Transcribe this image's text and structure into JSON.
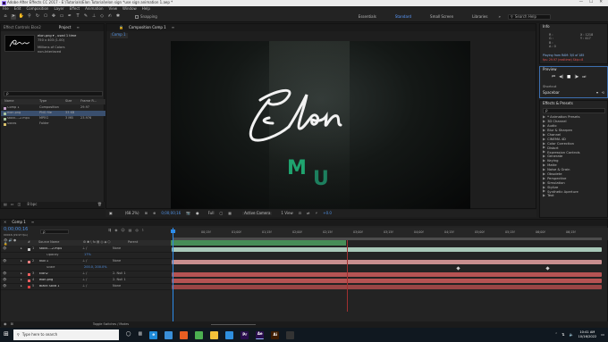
{
  "title_bar": {
    "title": "Adobe After Effects CC 2017 - E:\\Tutorials\\Elon Tutorial\\elon sign *use sign animation 1.aep *",
    "minimize": "—",
    "maximize": "☐",
    "close": "✕"
  },
  "menu": [
    "File",
    "Edit",
    "Composition",
    "Layer",
    "Effect",
    "Animation",
    "View",
    "Window",
    "Help"
  ],
  "toolbar": {
    "snapping_label": "Snapping",
    "workspaces": [
      "Essentials",
      "Standard",
      "Small Screen",
      "Libraries"
    ],
    "active_workspace": "Standard",
    "workspace_more": "»",
    "search_placeholder": "Search Help"
  },
  "project_panel": {
    "tabs": [
      "Effect Controls Elon2",
      "Project",
      "≡"
    ],
    "active_tab": "Project",
    "file_name": "elon.png ▾ , used 1 time",
    "dimensions": "750 x 403 (1.00)",
    "color_info": "Millions of Colors",
    "interlace": "non-Interlaced",
    "search_placeholder": "ρ",
    "columns": [
      "Name",
      "Type",
      "Size",
      "Frame R..."
    ],
    "items": [
      {
        "name": "Comp 1",
        "type": "Composition",
        "size": "",
        "fr": "29.97",
        "color": "#c1a0c8",
        "icon": "composition-icon"
      },
      {
        "name": "elon.png",
        "type": "PNG file",
        "size": "33 KB",
        "fr": "",
        "color": "#a7c4a0",
        "icon": "image-icon"
      },
      {
        "name": "stock-...2.mp4",
        "type": "MPEG",
        "size": "3 MB",
        "fr": "23.976",
        "color": "#a7c4a0",
        "icon": "footage-icon"
      },
      {
        "name": "Solids",
        "type": "Folder",
        "size": "",
        "fr": "",
        "color": "#d8c06a",
        "icon": "folder-icon"
      }
    ],
    "bpc": "8 bpc"
  },
  "composition_panel": {
    "tab_label": "Composition Comp 1",
    "breadcrumb": "Comp 1",
    "elon_text": "Elon",
    "mu_m": "M",
    "mu_u": "U",
    "zoom": "(68.2%)",
    "timecode": "0;00;00;16",
    "resolution": "Full",
    "camera": "Active Camera",
    "views": "1 View",
    "exposure": "+0.0"
  },
  "info_panel": {
    "title": "Info",
    "r": "R :",
    "g": "G :",
    "b": "B :",
    "a": "A : 0",
    "x": "X : 1218",
    "y": "Y : 417",
    "status1": "Playing from RAM: 3/0 of 185",
    "status2": "fps: 29.97 (realtime) Skip=8"
  },
  "preview_panel": {
    "title": "Preview",
    "shortcut_label": "Shortcut",
    "shortcut_value": "Spacebar"
  },
  "effects_panel": {
    "title": "Effects & Presets",
    "search_placeholder": "ρ",
    "items": [
      "* Animation Presets",
      "3D Channel",
      "Audio",
      "Blur & Sharpen",
      "Channel",
      "CINEMA 4D",
      "Color Correction",
      "Distort",
      "Expression Controls",
      "Generate",
      "Keying",
      "Matte",
      "Noise & Grain",
      "Obsolete",
      "Perspective",
      "Simulation",
      "Stylize",
      "Synthetic Aperture",
      "Text"
    ]
  },
  "timeline": {
    "comp_tab": "Comp 1",
    "timecode": "0;00;00;16",
    "frames": "00016 (29.97 fps)",
    "search_placeholder": "ρ",
    "columns": [
      "#",
      "Source Name",
      "Parent"
    ],
    "ruler": [
      "0f",
      "00;15f",
      "01;00f",
      "01;15f",
      "02;00f",
      "02;15f",
      "03;00f",
      "03;15f",
      "04;00f",
      "04;15f",
      "05;00f",
      "05;15f",
      "06;00f",
      "06;15f"
    ],
    "layers": [
      {
        "num": "1",
        "name": "stock-...2.mp4",
        "parent": "None",
        "color": "#c8c8c8",
        "bar": "#a8c8b8",
        "indent": 0
      },
      {
        "num": "",
        "name": "Opacity",
        "parent": "",
        "value": "17%",
        "color": "",
        "bar": "",
        "indent": 1
      },
      {
        "num": "2",
        "name": "Null 1",
        "parent": "None",
        "color": "#ee8080",
        "bar": "#c98e8e",
        "indent": 0
      },
      {
        "num": "",
        "name": "Scale",
        "parent": "",
        "value": "200.0, 200.0%",
        "color": "",
        "bar": "",
        "indent": 1
      },
      {
        "num": "3",
        "name": "Elon2",
        "parent": "2. Null 1",
        "color": "#ee6060",
        "bar": "#b65353",
        "indent": 0
      },
      {
        "num": "4",
        "name": "elon.png",
        "parent": "2. Null 1",
        "color": "#ee6060",
        "bar": "#b65353",
        "indent": 0
      },
      {
        "num": "5",
        "name": "Black Solid 1",
        "parent": "None",
        "color": "#dd4444",
        "bar": "#9a4545",
        "indent": 0
      }
    ],
    "toggle_label": "Toggle Switches / Modes"
  },
  "taskbar": {
    "search_placeholder": "Type here to search",
    "time": "10:41 AM",
    "date": "10/16/2022",
    "apps": [
      {
        "icon": "edge-icon",
        "label": "e",
        "color": "#1f8ad8"
      },
      {
        "icon": "store-icon",
        "label": "",
        "color": "#3a8fd9"
      },
      {
        "icon": "ps-icon",
        "label": "",
        "color": "#e85e22"
      },
      {
        "icon": "chrome-icon",
        "label": "",
        "color": "#4caf50"
      },
      {
        "icon": "explorer-icon",
        "label": "",
        "color": "#f3c13a"
      },
      {
        "icon": "vscode-icon",
        "label": "",
        "color": "#2f8fde"
      },
      {
        "icon": "premiere-icon",
        "label": "Pr",
        "color": "#2a0e4e"
      },
      {
        "icon": "ae-icon",
        "label": "Ae",
        "color": "#2a0e4e"
      },
      {
        "icon": "ai-icon",
        "label": "Ai",
        "color": "#3e1d00"
      },
      {
        "icon": "obs-icon",
        "label": "",
        "color": "#333"
      }
    ]
  },
  "colors": {
    "accent_blue": "#2d8ceb",
    "mu_green": "#1fa46f",
    "playhead": "#2d8ceb",
    "work_area": "#4da060"
  }
}
